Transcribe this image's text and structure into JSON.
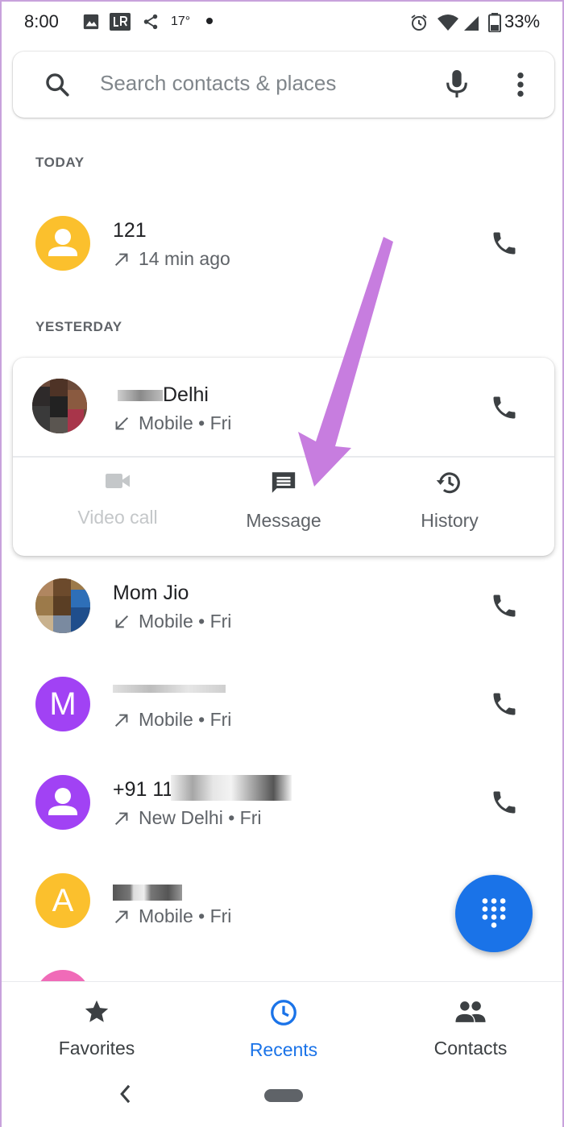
{
  "status_bar": {
    "time": "8:00",
    "temperature": "17°",
    "battery": "33%"
  },
  "search": {
    "placeholder": "Search contacts & places"
  },
  "sections": {
    "today": "TODAY",
    "yesterday": "YESTERDAY"
  },
  "calls": [
    {
      "name": "121",
      "sub": "14 min ago",
      "direction": "outgoing",
      "avatar_color": "#fbc02d"
    },
    {
      "name": "Delhi",
      "sub": "Mobile • Fri",
      "direction": "incoming"
    },
    {
      "name": "Mom Jio",
      "sub": "Mobile • Fri",
      "direction": "incoming"
    },
    {
      "name": "",
      "sub": "Mobile • Fri",
      "direction": "outgoing",
      "avatar_letter": "M",
      "avatar_color": "#a142f4"
    },
    {
      "name": "+91 11",
      "sub": "New Delhi • Fri",
      "direction": "outgoing",
      "avatar_color": "#a142f4"
    },
    {
      "name": "",
      "sub": "Mobile • Fri",
      "direction": "outgoing",
      "avatar_letter": "A",
      "avatar_color": "#fbc02d"
    }
  ],
  "card_actions": {
    "video_call": "Video call",
    "message": "Message",
    "history": "History"
  },
  "bottom_nav": {
    "favorites": "Favorites",
    "recents": "Recents",
    "contacts": "Contacts",
    "active": "recents"
  },
  "colors": {
    "accent": "#1a73e8",
    "annotation_arrow": "#c77ddf"
  },
  "icons": {
    "search": "search-icon",
    "mic": "mic-icon",
    "more": "more-vert-icon",
    "call": "phone-icon",
    "dialpad": "dialpad-icon"
  }
}
